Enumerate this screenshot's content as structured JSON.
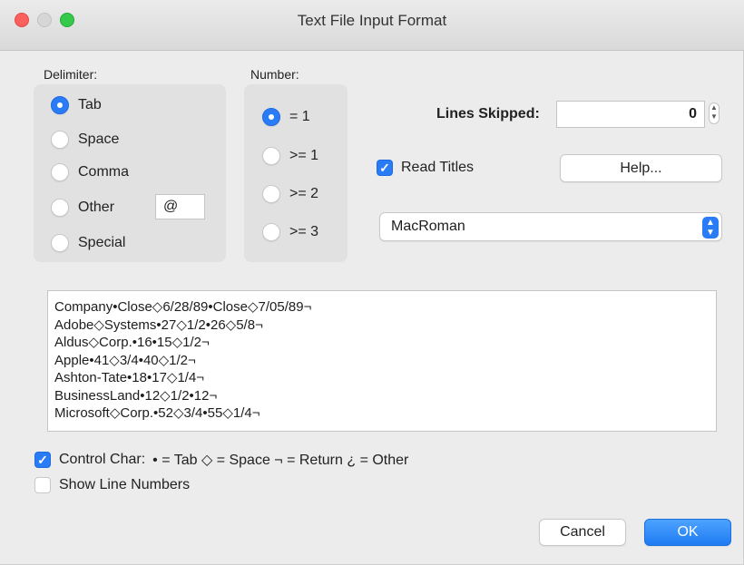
{
  "window": {
    "title": "Text File Input Format"
  },
  "delimiter": {
    "label": "Delimiter:",
    "options": [
      {
        "label": "Tab",
        "selected": true
      },
      {
        "label": "Space",
        "selected": false
      },
      {
        "label": "Comma",
        "selected": false
      },
      {
        "label": "Other",
        "selected": false
      },
      {
        "label": "Special",
        "selected": false
      }
    ],
    "other_value": "@"
  },
  "number": {
    "label": "Number:",
    "options": [
      {
        "label": "= 1",
        "selected": true
      },
      {
        "label": ">= 1",
        "selected": false
      },
      {
        "label": ">= 2",
        "selected": false
      },
      {
        "label": ">= 3",
        "selected": false
      }
    ]
  },
  "lines_skipped": {
    "label": "Lines Skipped:",
    "value": "0"
  },
  "read_titles": {
    "label": "Read Titles",
    "checked": true
  },
  "help_button": "Help...",
  "encoding": {
    "selected": "MacRoman"
  },
  "preview": {
    "lines": [
      "Company•Close◇6/28/89•Close◇7/05/89¬",
      "Adobe◇Systems•27◇1/2•26◇5/8¬",
      "Aldus◇Corp.•16•15◇1/2¬",
      "Apple•41◇3/4•40◇1/2¬",
      "Ashton-Tate•18•17◇1/4¬",
      "BusinessLand•12◇1/2•12¬",
      "Microsoft◇Corp.•52◇3/4•55◇1/4¬"
    ]
  },
  "control_char": {
    "label": "Control Char:",
    "checked": true,
    "legend": "• = Tab  ◇ = Space  ¬ = Return  ¿ = Other"
  },
  "show_line_numbers": {
    "label": "Show Line Numbers",
    "checked": false
  },
  "buttons": {
    "cancel": "Cancel",
    "ok": "OK"
  },
  "colors": {
    "accent": "#2a7cf6",
    "window_bg": "#ececec",
    "panel_bg": "#e1e1e1"
  }
}
